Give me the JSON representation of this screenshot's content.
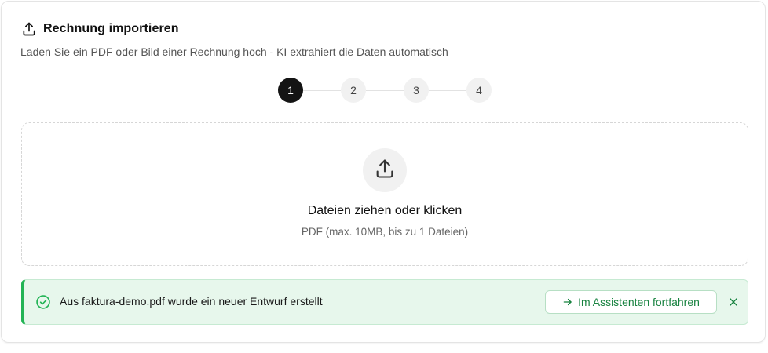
{
  "header": {
    "icon": "upload-icon",
    "title": "Rechnung importieren",
    "subtitle": "Laden Sie ein PDF oder Bild einer Rechnung hoch - KI extrahiert die Daten automatisch"
  },
  "stepper": {
    "steps": [
      "1",
      "2",
      "3",
      "4"
    ],
    "active_step": 1
  },
  "dropzone": {
    "icon": "upload-icon",
    "title": "Dateien ziehen oder klicken",
    "hint": "PDF (max. 10MB, bis zu 1 Dateien)"
  },
  "notice": {
    "icon": "check-circle-icon",
    "message": "Aus faktura-demo.pdf wurde ein neuer Entwurf erstellt",
    "action_label": "Im Assistenten fortfahren",
    "action_icon": "arrow-right-icon",
    "close_icon": "close-icon"
  },
  "colors": {
    "accent_dark": "#141414",
    "success": "#22b455",
    "success_text": "#17823f",
    "success_bg": "#e7f7ec"
  }
}
